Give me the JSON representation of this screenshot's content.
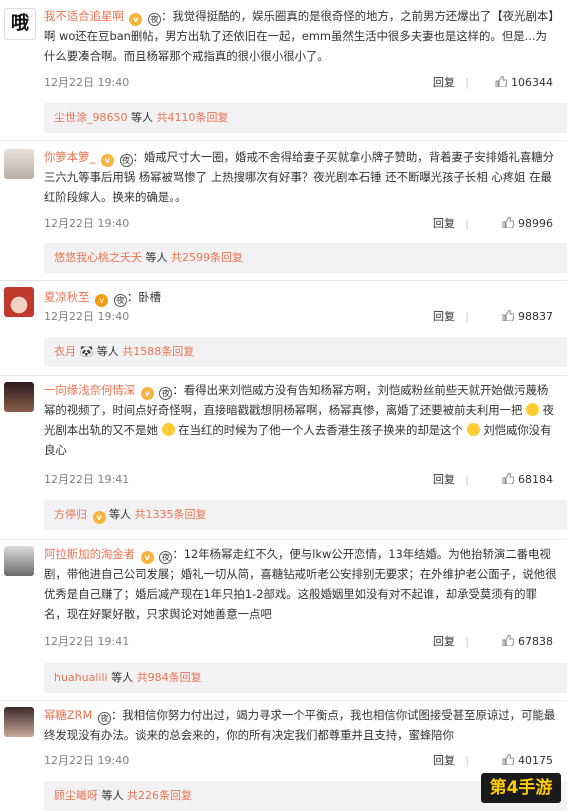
{
  "comments": [
    {
      "username": "我不适合追星啊",
      "text": "我觉得挺酷的，娱乐圈真的是很奇怪的地方，之前男方还爆出了【夜光剧本】啊 wo还在豆ban删帖，男方出轨了还依旧在一起，emm虽然生活中很多夫妻也是这样的。但是...为什么要凑合啊。而且杨幂那个戒指真的很小很小很小了。",
      "time": "12月22日 19:40",
      "reply_label": "回复",
      "likes": "106344",
      "sub_user": "尘世涂_98650",
      "sub_suffix": "等人",
      "sub_more": "共4110条回复"
    },
    {
      "username": "你箩本箩_",
      "text": "婚戒尺寸大一圈，婚戒不舍得给妻子买就拿小牌子赞助，背着妻子安排婚礼喜糖分三六九等事后用锅 杨幂被骂惨了 上热搜哪次有好事？夜光剧本石锤 还不断曝光孩子长相 心疼姐 在最红阶段嫁人。换来的确是。。",
      "time": "12月22日 19:40",
      "reply_label": "回复",
      "likes": "98996",
      "sub_user": "悠悠我心桃之夭夭",
      "sub_suffix": "等人",
      "sub_more": "共2599条回复"
    },
    {
      "username": "夏凉秋至",
      "text": "卧槽",
      "time": "12月22日 19:40",
      "reply_label": "回复",
      "likes": "98837",
      "sub_user": "衣月",
      "sub_suffix": "等人",
      "sub_more": "共1588条回复"
    },
    {
      "username": "一向缘浅奈何情深",
      "text_a": "看得出来刘恺威方没有告知杨幂方啊，刘恺威粉丝前些天就开始做污蔑杨幂的视频了，时间点好奇怪啊，直接暗戳戳想阴杨幂啊，杨幂真惨，离婚了还要被前夫利用一把",
      "text_b": "夜光剧本出轨的又不是她",
      "text_c": "在当红的时候为了他一个人去香港生孩子换来的却是这个",
      "text_d": "刘恺威你没有良心",
      "time": "12月22日 19:41",
      "reply_label": "回复",
      "likes": "68184",
      "sub_user": "方停归",
      "sub_suffix": "等人",
      "sub_more": "共1335条回复"
    },
    {
      "username": "阿拉斯加的淘金者",
      "text": "12年杨幂走红不久，便与lkw公开恋情，13年结婚。为他抬轿演二番电视剧，带他进自己公司发展；婚礼一切从简，喜糖钻戒听老公安排别无要求；在外维护老公面子，说他很优秀是自己赚了；婚后减产现在1年只拍1-2部戏。这般婚姻里如没有对不起谁，却承受莫须有的罪名，现在好聚好散，只求舆论对她善意一点吧",
      "time": "12月22日 19:41",
      "reply_label": "回复",
      "likes": "67838",
      "sub_user": "huahualili",
      "sub_suffix": "等人",
      "sub_more": "共984条回复"
    },
    {
      "username": "幂糖ZRM",
      "text": "我相信你努力付出过，竭力寻求一个平衡点，我也相信你试图接受甚至原谅过，可能最终发现没有办法。谈来的总会来的，你的所有决定我们都尊重并且支持，蜜蜂陪你",
      "time": "12月22日 19:40",
      "reply_label": "回复",
      "likes": "40175",
      "sub_user": "顾尘曦呀",
      "sub_suffix": "等人",
      "sub_more": "共226条回复"
    }
  ],
  "watermark": "第4手游",
  "colors": {
    "accent": "#eb7350",
    "sub_bg": "#f2f2f5",
    "meta": "#808080"
  },
  "icons": {
    "like": "thumbs-up-icon",
    "vip_badge": "vip-badge-icon",
    "dark_badge": "level-badge-icon"
  }
}
